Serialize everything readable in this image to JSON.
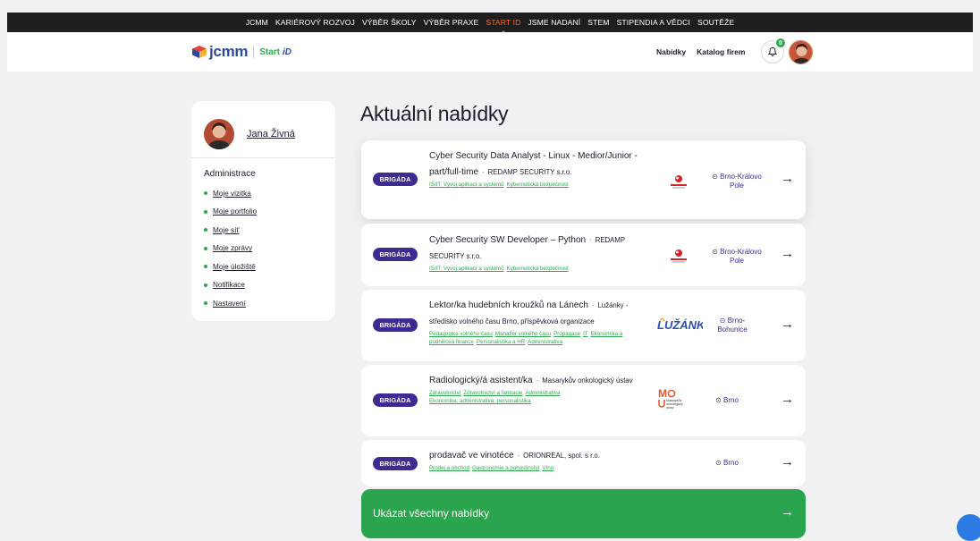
{
  "topnav": {
    "items": [
      "JCMM",
      "KARIÉROVÝ ROZVOJ",
      "VÝBĚR ŠKOLY",
      "VÝBĚR PRAXE",
      "START ID",
      "JSME NADANÍ",
      "STEM",
      "STIPENDIA A VĚDCI",
      "SOUTĚŽE"
    ],
    "active": "START ID"
  },
  "header": {
    "logo_text": "jcmm",
    "logo_sub": "Start",
    "logo_id": "iD",
    "nav": [
      "Nabídky",
      "Katalog firem"
    ],
    "notifications_count": "0"
  },
  "sidebar": {
    "user_name": "Jana Živná",
    "section_title": "Administrace",
    "items": [
      "Moje vizitka",
      "Moje portfolio",
      "Moje síť",
      "Moje zprávy",
      "Moje úložiště",
      "Notifikace",
      "Nastavení"
    ]
  },
  "main": {
    "title": "Aktuální nabídky",
    "show_all": "Ukázat všechny nabídky",
    "arrow": "→",
    "jobs": [
      {
        "tag": "BRIGÁDA",
        "title": "Cyber Security Data Analyst - Linux - Medior/Junior - part/full-time",
        "company": "REDAMP SECURITY s.r.o.",
        "categories": [
          "IS/IT: Vývoj aplikací a systémů",
          "Kybernetická bezpečnost"
        ],
        "logo": "REDAMP",
        "location": "Brno-Královo Pole"
      },
      {
        "tag": "BRIGÁDA",
        "title": "Cyber Security SW Developer – Python",
        "company": "REDAMP SECURITY s.r.o.",
        "categories": [
          "IS/IT: Vývoj aplikací a systémů",
          "Kybernetická bezpečnost"
        ],
        "logo": "REDAMP",
        "location": "Brno-Královo Pole"
      },
      {
        "tag": "BRIGÁDA",
        "title": "Lektor/ka hudebních kroužků na Lánech",
        "company": "Lužánky - středisko volného času Brno, příspěvková organizace",
        "categories": [
          "Pedagogika volného času",
          "Manažer volného času",
          "Propagace",
          "IT",
          "Ekonomika a podniková finance",
          "Personalistika a HR",
          "Administrativa"
        ],
        "logo": "LUŽÁNKY",
        "location": "Brno-Bohunice"
      },
      {
        "tag": "BRIGÁDA",
        "title": "Radiologický/á asistent/ka",
        "company": "Masarykův onkologický ústav",
        "categories": [
          "Zdravotnictví",
          "Zdravotnictví a farmacie",
          "Administrativa",
          "Ekonomika, administrativa, personalistika"
        ],
        "logo": "Masarykův onkologický ústav",
        "location": "Brno"
      },
      {
        "tag": "BRIGÁDA",
        "title": "prodavač ve vinotéce",
        "company": "ORIONREAL, spol. s r.o.",
        "categories": [
          "Prodej a obchod",
          "Gastronomie a pohostinství",
          "Víno"
        ],
        "logo": "",
        "location": "Brno"
      }
    ]
  },
  "colors": {
    "accent_green": "#2ba44e",
    "tag_purple": "#3f2a94",
    "nav_active": "#f26a2e"
  }
}
